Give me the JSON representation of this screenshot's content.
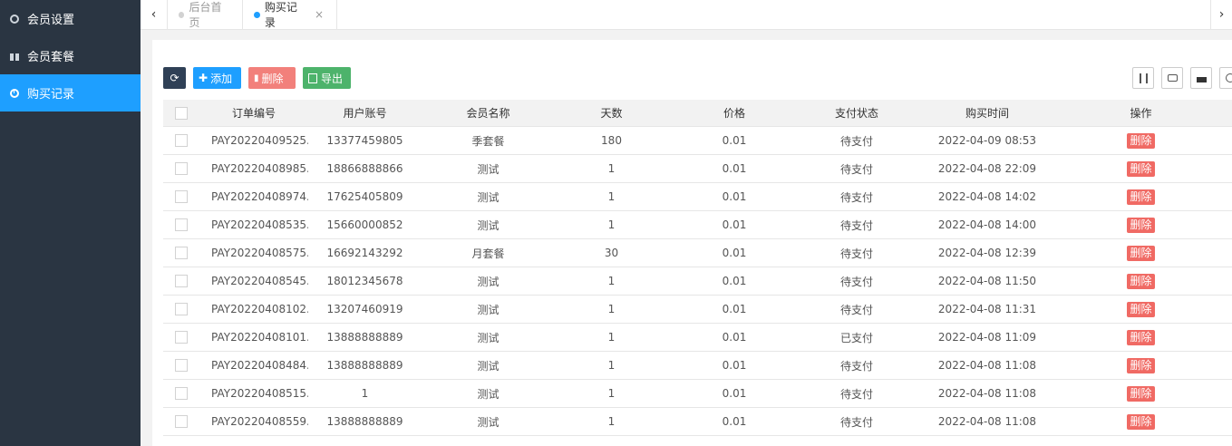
{
  "sidebar": {
    "items": [
      {
        "label": "会员设置",
        "icon": "gear-icon"
      },
      {
        "label": "会员套餐",
        "icon": "gift-icon"
      },
      {
        "label": "购买记录",
        "icon": "clock-icon",
        "active": true
      }
    ]
  },
  "tabs": {
    "left_arrow": "‹",
    "right_arrow": "›",
    "home": "后台首页",
    "current": "购买记录",
    "close": "×"
  },
  "toolbar": {
    "refresh_icon": "⟳",
    "add_icon": "✚",
    "add_label": "添加",
    "delete_icon": "🗑",
    "delete_label": "删除",
    "export_icon": "⇪",
    "export_label": "导出"
  },
  "table": {
    "headers": {
      "order": "订单编号",
      "user": "用户账号",
      "name": "会员名称",
      "days": "天数",
      "price": "价格",
      "status": "支付状态",
      "time": "购买时间",
      "op": "操作"
    },
    "rows": [
      {
        "order": "PAY20220409525...",
        "user": "13377459805",
        "name": "季套餐",
        "days": "180",
        "price": "0.01",
        "status": "待支付",
        "time": "2022-04-09 08:53",
        "op": "删除"
      },
      {
        "order": "PAY20220408985...",
        "user": "18866888866",
        "name": "测试",
        "days": "1",
        "price": "0.01",
        "status": "待支付",
        "time": "2022-04-08 22:09",
        "op": "删除"
      },
      {
        "order": "PAY20220408974...",
        "user": "17625405809",
        "name": "测试",
        "days": "1",
        "price": "0.01",
        "status": "待支付",
        "time": "2022-04-08 14:02",
        "op": "删除"
      },
      {
        "order": "PAY20220408535...",
        "user": "15660000852",
        "name": "测试",
        "days": "1",
        "price": "0.01",
        "status": "待支付",
        "time": "2022-04-08 14:00",
        "op": "删除"
      },
      {
        "order": "PAY20220408575...",
        "user": "16692143292",
        "name": "月套餐",
        "days": "30",
        "price": "0.01",
        "status": "待支付",
        "time": "2022-04-08 12:39",
        "op": "删除"
      },
      {
        "order": "PAY20220408545...",
        "user": "18012345678",
        "name": "测试",
        "days": "1",
        "price": "0.01",
        "status": "待支付",
        "time": "2022-04-08 11:50",
        "op": "删除"
      },
      {
        "order": "PAY20220408102...",
        "user": "13207460919",
        "name": "测试",
        "days": "1",
        "price": "0.01",
        "status": "待支付",
        "time": "2022-04-08 11:31",
        "op": "删除"
      },
      {
        "order": "PAY20220408101...",
        "user": "13888888889",
        "name": "测试",
        "days": "1",
        "price": "0.01",
        "status": "已支付",
        "time": "2022-04-08 11:09",
        "op": "删除"
      },
      {
        "order": "PAY20220408484...",
        "user": "13888888889",
        "name": "测试",
        "days": "1",
        "price": "0.01",
        "status": "待支付",
        "time": "2022-04-08 11:08",
        "op": "删除"
      },
      {
        "order": "PAY20220408515...",
        "user": "1",
        "name": "测试",
        "days": "1",
        "price": "0.01",
        "status": "待支付",
        "time": "2022-04-08 11:08",
        "op": "删除"
      },
      {
        "order": "PAY20220408559...",
        "user": "13888888889",
        "name": "测试",
        "days": "1",
        "price": "0.01",
        "status": "待支付",
        "time": "2022-04-08 11:08",
        "op": "删除"
      }
    ]
  },
  "colors": {
    "sidebar_bg": "#2a3542",
    "accent": "#1e9fff",
    "danger": "#f06a64",
    "success": "#4db36b",
    "dark_button": "#2f4056"
  }
}
